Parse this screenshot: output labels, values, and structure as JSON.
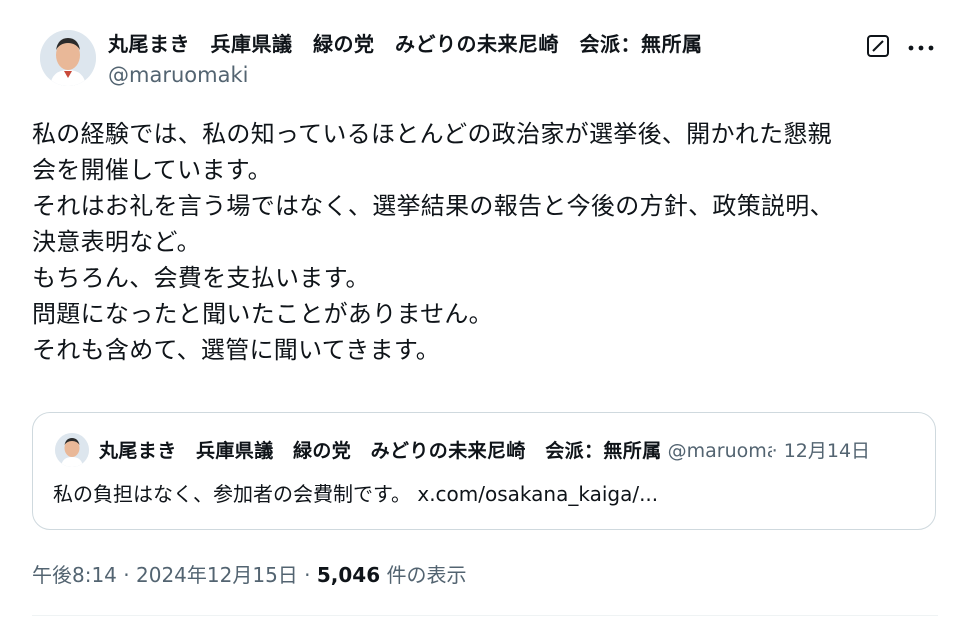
{
  "author": {
    "display_name": "丸尾まき　兵庫県議　緑の党　みどりの未来尼崎　会派：無所属",
    "handle": "@maruomaki"
  },
  "post": {
    "text": "私の経験では、私の知っているほとんどの政治家が選挙後、開かれた懇親\n会を開催しています。\nそれはお礼を言う場ではなく、選挙結果の報告と今後の方針、政策説明、\n決意表明など。\nもちろん、会費を支払います。\n問題になったと聞いたことがありません。\nそれも含めて、選管に聞いてきます。"
  },
  "quoted": {
    "display_name": "丸尾まき　兵庫県議　緑の党　みどりの未来尼崎　会派：無所属",
    "handle": "@maruomaki",
    "date": "· 12月14日",
    "text": "私の負担はなく、参加者の会費制です。 x.com/osakana_kaiga/..."
  },
  "meta": {
    "time": "午後8:14",
    "sep": " · ",
    "date": "2024年12月15日",
    "views_count": "5,046",
    "views_label": " 件の表示"
  },
  "icons": {
    "grok": "grok-icon",
    "more": "more-icon"
  }
}
